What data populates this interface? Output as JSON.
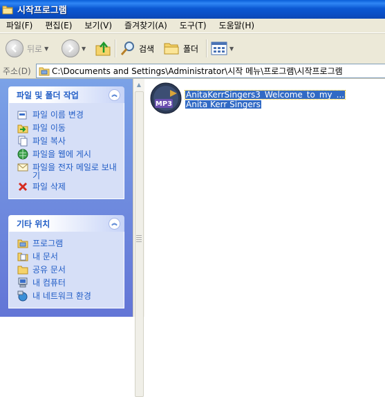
{
  "window": {
    "title": "시작프로그램"
  },
  "menu": [
    "파일(F)",
    "편집(E)",
    "보기(V)",
    "즐겨찾기(A)",
    "도구(T)",
    "도움말(H)"
  ],
  "toolbar": {
    "back": "뒤로",
    "search": "검색",
    "folders": "폴더"
  },
  "address": {
    "label": "주소(D)",
    "path": "C:\\Documents and Settings\\Administrator\\시작 메뉴\\프로그램\\시작프로그램"
  },
  "panels": {
    "file_tasks": {
      "title": "파일 및 폴더 작업",
      "items": [
        {
          "label": "파일 이름 변경",
          "icon": "rename-icon"
        },
        {
          "label": "파일 이동",
          "icon": "move-icon"
        },
        {
          "label": "파일 복사",
          "icon": "copy-icon"
        },
        {
          "label": "파일을 웹에 게시",
          "icon": "publish-web-icon"
        },
        {
          "label": "파일을 전자 메일로 보내기",
          "icon": "email-icon"
        },
        {
          "label": "파일 삭제",
          "icon": "delete-icon"
        }
      ]
    },
    "other_places": {
      "title": "기타 위치",
      "items": [
        {
          "label": "프로그램",
          "icon": "programs-folder-icon"
        },
        {
          "label": "내 문서",
          "icon": "my-documents-icon"
        },
        {
          "label": "공유 문서",
          "icon": "shared-documents-icon"
        },
        {
          "label": "내 컴퓨터",
          "icon": "my-computer-icon"
        },
        {
          "label": "내 네트워크 환경",
          "icon": "network-places-icon"
        }
      ]
    }
  },
  "files": [
    {
      "name": "AnitaKerrSingers3_Welcome_to_my_...",
      "artist": "Anita Kerr Singers",
      "badge": "MP3",
      "icon": "mp3-file-icon"
    }
  ],
  "colors": {
    "title_bar": "#0a5fd8",
    "task_pane": "#7ba2e7",
    "link": "#215dc6",
    "selection": "#316ac5"
  }
}
